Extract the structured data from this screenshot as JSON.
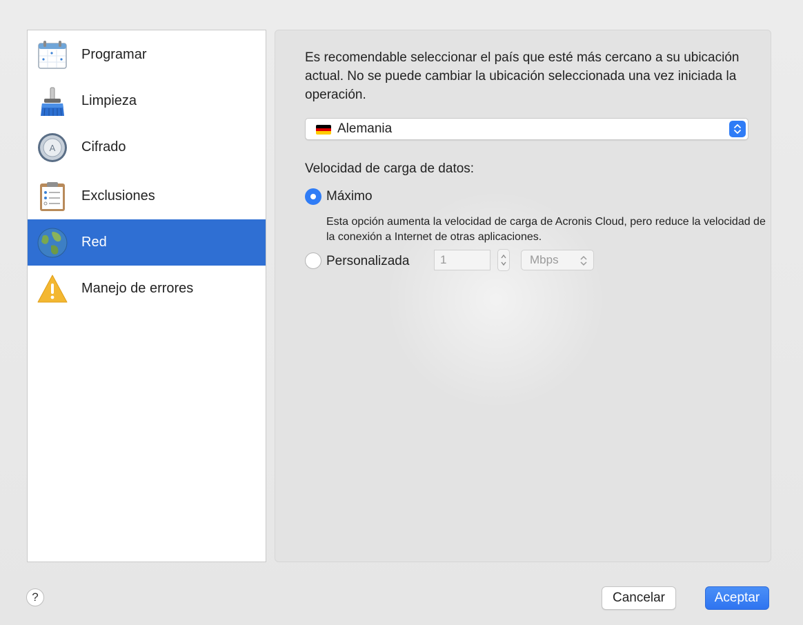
{
  "sidebar": {
    "items": [
      {
        "label": "Programar",
        "icon": "calendar-icon"
      },
      {
        "label": "Limpieza",
        "icon": "broom-icon"
      },
      {
        "label": "Cifrado",
        "icon": "lock-dial-icon"
      },
      {
        "label": "Exclusiones",
        "icon": "clipboard-list-icon"
      },
      {
        "label": "Red",
        "icon": "globe-icon",
        "selected": true
      },
      {
        "label": "Manejo de errores",
        "icon": "warning-icon"
      }
    ]
  },
  "main": {
    "intro_text": "Es recomendable seleccionar el país que esté más cercano a su ubicación actual. No se puede cambiar la ubicación seleccionada una vez iniciada la operación.",
    "country": {
      "value": "Alemania",
      "flag": "germany-flag-icon"
    },
    "upload_speed_label": "Velocidad de carga de datos:",
    "options": {
      "max": {
        "label": "Máximo",
        "selected": true,
        "description": "Esta opción aumenta la velocidad de carga de Acronis Cloud, pero reduce la velocidad de la conexión a Internet de otras aplicaciones."
      },
      "custom": {
        "label": "Personalizada",
        "selected": false,
        "value": "1",
        "unit": "Mbps"
      }
    }
  },
  "footer": {
    "help_label": "?",
    "cancel_label": "Cancelar",
    "ok_label": "Aceptar"
  },
  "colors": {
    "accent": "#2f7cf6",
    "selection": "#2f6fd3"
  }
}
